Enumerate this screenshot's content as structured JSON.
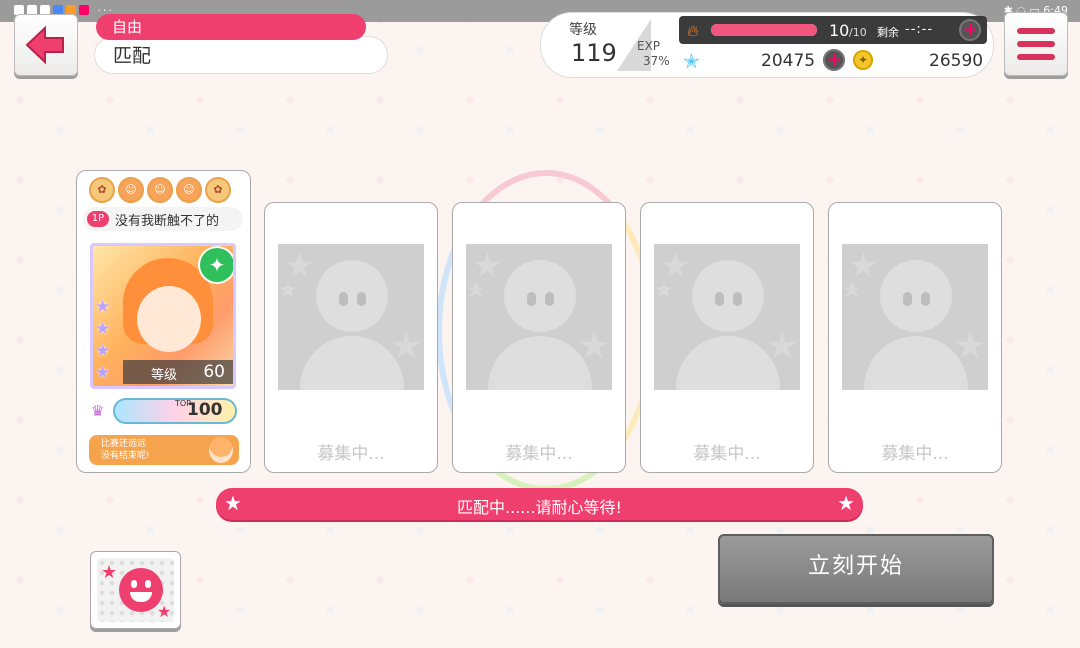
{
  "statusbar": {
    "left_icons": "◆◆◆◆◆◆ ···",
    "time": "6:49"
  },
  "mode": {
    "category": "自由",
    "name": "匹配"
  },
  "player_status": {
    "level_label": "等级",
    "level": "119",
    "exp_label": "EXP",
    "exp_percent": "37%",
    "exp_fill": 0.37,
    "stamina_current": "10",
    "stamina_max": "/10",
    "stamina_fill": 1.0,
    "remaining_label": "剩余",
    "remaining_time": "--:--",
    "stars": "20475",
    "coins": "26590"
  },
  "icons": {
    "back": "back-arrow-icon",
    "menu": "hamburger-menu-icon",
    "stamina": "flame-icon",
    "stars": "star-gem-icon",
    "coins": "coin-icon"
  },
  "colors": {
    "accent": "#ef3f6e",
    "start_button": "#8a8a8a"
  },
  "player_card": {
    "tag": "1P",
    "name": "没有我断触不了的",
    "card_level_label": "等级",
    "card_level": "60",
    "card_stars": [
      "★",
      "★",
      "★",
      "★"
    ],
    "rank_top_label": "TOP",
    "rank_value": "100",
    "comment_line1": "比赛还远远",
    "comment_line2": "没有结束呢!"
  },
  "slots": [
    {
      "label": "募集中..."
    },
    {
      "label": "募集中..."
    },
    {
      "label": "募集中..."
    },
    {
      "label": "募集中..."
    }
  ],
  "match_banner": {
    "text": "匹配中......请耐心等待!"
  },
  "start_button": {
    "label": "立刻开始"
  }
}
